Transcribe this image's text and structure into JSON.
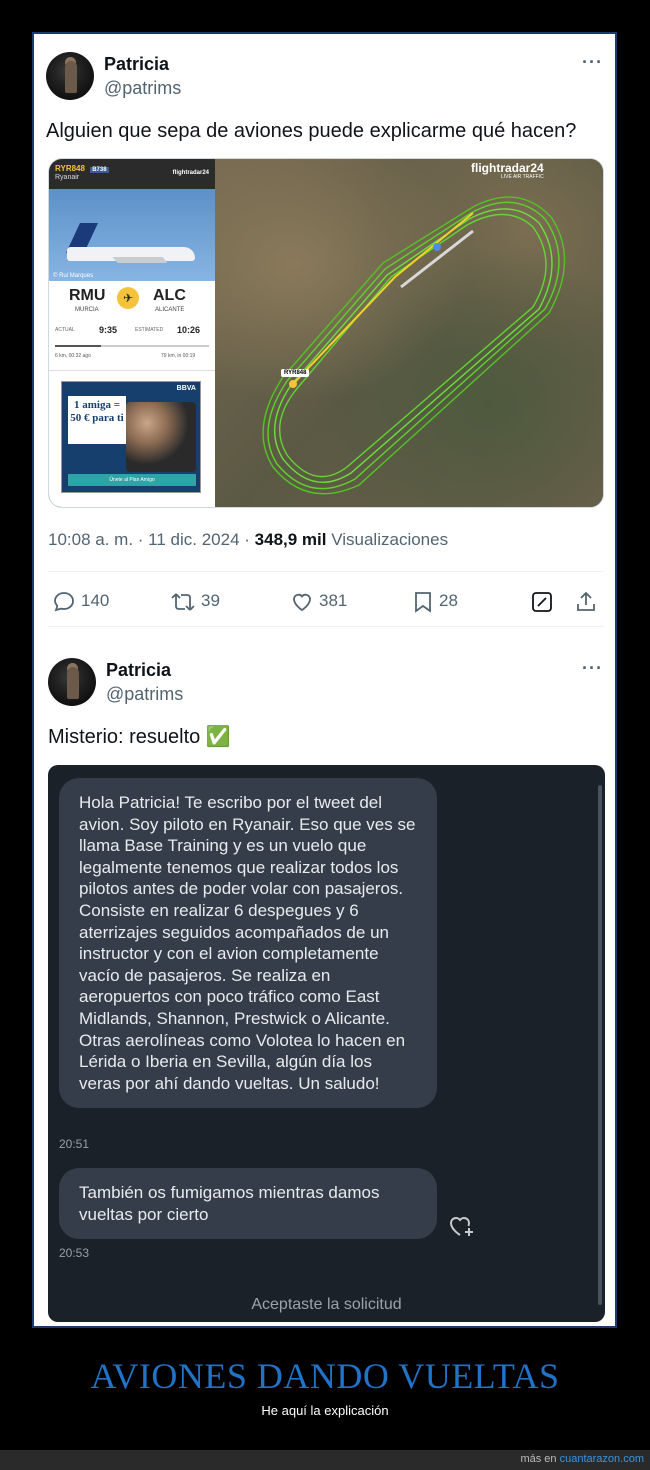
{
  "tweet1": {
    "name": "Patricia",
    "handle": "@patrims",
    "text": "Alguien que sepa de aviones puede explicarme qué hacen?",
    "time": "10:08 a. m. · 11 dic. 2024 ·",
    "views_count": "348,9 mil",
    "views_label": "Visualizaciones",
    "replies": "140",
    "retweets": "39",
    "likes": "381",
    "bookmarks": "28"
  },
  "flight_image": {
    "flight": "RYR848",
    "aircraft": "B738",
    "airline": "Ryanair",
    "provider": "flightradar24",
    "provider_tag": "LIVE AIR TRAFFIC",
    "photo_credit": "© Rui Marques",
    "origin_code": "RMU",
    "origin_city": "MURCIA",
    "destination_code": "ALC",
    "destination_city": "ALICANTE",
    "actual_label": "ACTUAL",
    "actual_time": "9:35",
    "estimated_label": "ESTIMATED",
    "estimated_time": "10:26",
    "progress": 0.3,
    "left_info": "6 km, 00:32 ago",
    "right_info": "79 km, in 00:19",
    "ad_text": "1 amiga = 50 € para ti",
    "ad_brand": "BBVA",
    "ad_cta": "Únete al Plan Amigo",
    "callsign_label": "RYR848"
  },
  "tweet2": {
    "name": "Patricia",
    "handle": "@patrims",
    "text": "Misterio: resuelto ✅"
  },
  "chat": {
    "message1": "Hola Patricia! Te escribo por el tweet del avion. Soy piloto en Ryanair. Eso que ves se llama Base Training y es un vuelo que legalmente tenemos que realizar todos los pilotos antes de poder volar con pasajeros. Consiste en realizar 6 despegues y 6 aterrizajes seguidos acompañados de un instructor y con el avion completamente vacío de pasajeros. Se realiza en aeropuertos con poco tráfico como East Midlands, Shannon, Prestwick o Alicante. Otras aerolíneas como Volotea lo hacen en Lérida o Iberia en Sevilla, algún día los veras por ahí dando vueltas. Un saludo!",
    "time1": "20:51",
    "message2": "También os fumigamos mientras damos vueltas por cierto",
    "time2": "20:53",
    "accepted": "Aceptaste la solicitud"
  },
  "caption": {
    "title": "AVIONES DANDO VUELTAS",
    "subtitle": "He aquí la explicación"
  },
  "footer": {
    "prefix": "más en",
    "site": "cuantarazon.com"
  },
  "colors": {
    "caption": "#1f73c9",
    "track_green": "#5fd12c",
    "track_yellow": "#f2d12a"
  }
}
